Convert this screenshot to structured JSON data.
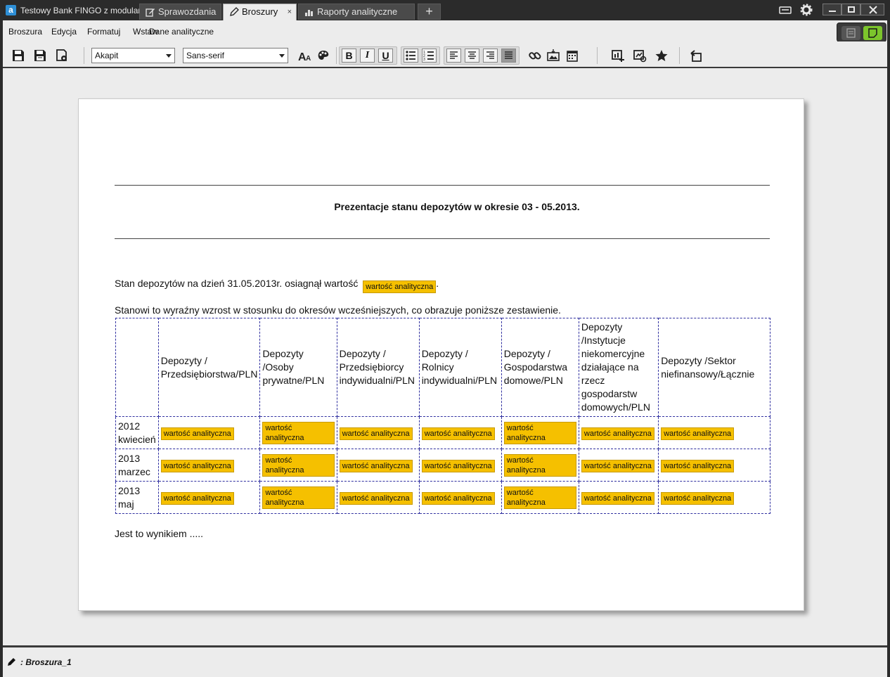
{
  "window": {
    "app_title": "Testowy Bank FINGO z modulami",
    "logo_letter": "a",
    "tabs": [
      {
        "label": "Sprawozdania",
        "icon": "edit-icon"
      },
      {
        "label": "Broszury",
        "icon": "pen-icon",
        "close": "×"
      },
      {
        "label": "Raporty analityczne",
        "icon": "chart-icon"
      }
    ],
    "add_tab": "+"
  },
  "menu": [
    "Broszura",
    "Edycja",
    "Formatuj",
    "Wstaw",
    "Dane analityczne"
  ],
  "toolbar": {
    "paragraph_style": "Akapit",
    "font_family": "Sans-serif",
    "bold": "B",
    "italic": "I",
    "underline": "U"
  },
  "document": {
    "title": "Prezentacje stanu depozytów w okresie 03 - 05.2013.",
    "para1": "Stan depozytów na dzień 31.05.2013r. osiagnął wartość",
    "para2": "Stanowi to wyraźny wzrost w stosunku do okresów wcześniejszych, co obrazuje poniższe zestawienie.",
    "para3": "Jest to wynikiem .....",
    "tag_label": "wartość analityczna",
    "table": {
      "headers": [
        "",
        "Depozyty / Przedsiębiorstwa/PLN",
        "Depozyty /Osoby prywatne/PLN",
        "Depozyty / Przedsiębiorcy indywidualni/PLN",
        "Depozyty / Rolnicy indywidualni/PLN",
        "Depozyty / Gospodarstwa domowe/PLN",
        "Depozyty /Instytucje niekomercyjne działające na rzecz gospodarstw domowych/PLN",
        "Depozyty /Sektor niefinansowy/Łącznie"
      ],
      "rows": [
        {
          "year": "2012",
          "month": "kwiecień"
        },
        {
          "year": "2013",
          "month": "marzec"
        },
        {
          "year": "2013",
          "month": "maj"
        }
      ]
    }
  },
  "status": {
    "text": ": Broszura_1"
  }
}
